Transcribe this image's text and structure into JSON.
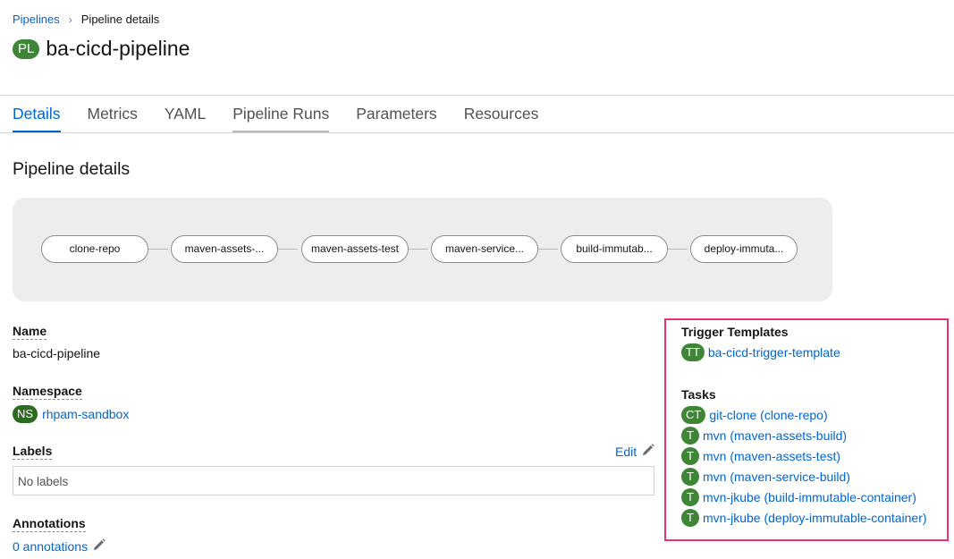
{
  "breadcrumb": {
    "parent": "Pipelines",
    "separator": "›",
    "current": "Pipeline details"
  },
  "header": {
    "badge": "PL",
    "title": "ba-cicd-pipeline"
  },
  "tabs": [
    {
      "label": "Details",
      "active": true
    },
    {
      "label": "Metrics"
    },
    {
      "label": "YAML"
    },
    {
      "label": "Pipeline Runs",
      "hovered": true
    },
    {
      "label": "Parameters"
    },
    {
      "label": "Resources"
    }
  ],
  "section_title": "Pipeline details",
  "graph": {
    "nodes": [
      "clone-repo",
      "maven-assets-...",
      "maven-assets-test",
      "maven-service...",
      "build-immutab...",
      "deploy-immuta..."
    ]
  },
  "details": {
    "name_label": "Name",
    "name_value": "ba-cicd-pipeline",
    "namespace_label": "Namespace",
    "namespace_badge": "NS",
    "namespace_value": "rhpam-sandbox",
    "labels_label": "Labels",
    "labels_edit": "Edit",
    "labels_value": "No labels",
    "annotations_label": "Annotations",
    "annotations_link": "0 annotations"
  },
  "right": {
    "trigger_templates_label": "Trigger Templates",
    "trigger_template": {
      "badge": "TT",
      "name": "ba-cicd-trigger-template"
    },
    "tasks_label": "Tasks",
    "tasks": [
      {
        "badge": "CT",
        "name": "git-clone (clone-repo)"
      },
      {
        "badge": "T",
        "name": "mvn (maven-assets-build)"
      },
      {
        "badge": "T",
        "name": "mvn (maven-assets-test)"
      },
      {
        "badge": "T",
        "name": "mvn (maven-service-build)"
      },
      {
        "badge": "T",
        "name": "mvn-jkube (build-immutable-container)"
      },
      {
        "badge": "T",
        "name": "mvn-jkube (deploy-immutable-container)"
      }
    ]
  },
  "colors": {
    "link": "#0066cc",
    "badge_green": "#3e8635",
    "highlight": "#e8336d"
  },
  "icons": {
    "breadcrumb_separator": "chevron-right-icon",
    "edit": "pencil-icon"
  }
}
